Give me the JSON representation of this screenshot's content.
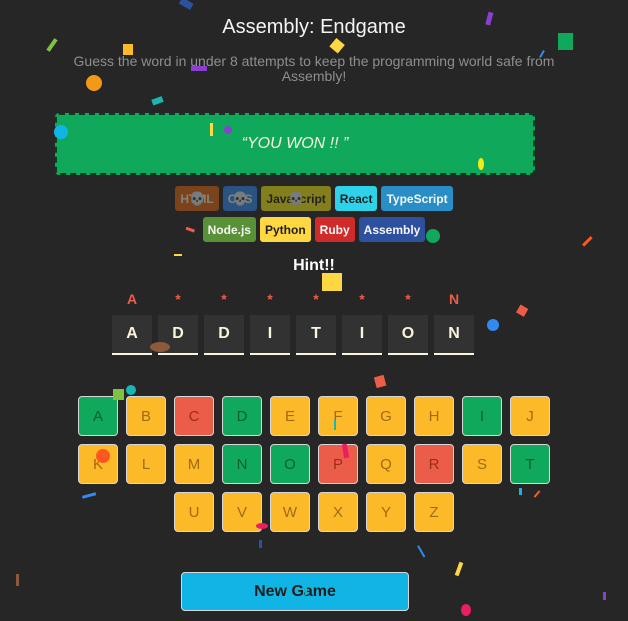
{
  "header": {
    "title": "Assembly: Endgame",
    "subtitle": "Guess the word in under 8 attempts to keep the programming world safe from Assembly!"
  },
  "status": {
    "message": "“YOU WON !! ”",
    "color": "#10a95b"
  },
  "languages": [
    {
      "name": "HTML",
      "bg": "#e2680f",
      "fg": "#f9f4da",
      "lost": true
    },
    {
      "name": "CSS",
      "bg": "#328af1",
      "fg": "#f9f4da",
      "lost": true
    },
    {
      "name": "Javascript",
      "bg": "#f4eb13",
      "fg": "#1e1e1e",
      "lost": true
    },
    {
      "name": "React",
      "bg": "#2ed3e9",
      "fg": "#1e1e1e",
      "lost": false
    },
    {
      "name": "TypeScript",
      "bg": "#298ec6",
      "fg": "#f5f5f5",
      "lost": false
    },
    {
      "name": "Node.js",
      "bg": "#599137",
      "fg": "#f5f5f5",
      "lost": false
    },
    {
      "name": "Python",
      "bg": "#ffd742",
      "fg": "#1e1e1e",
      "lost": false
    },
    {
      "name": "Ruby",
      "bg": "#d02b2b",
      "fg": "#f5f5f5",
      "lost": false
    },
    {
      "name": "Assembly",
      "bg": "#2d519f",
      "fg": "#f5f5f5",
      "lost": false
    }
  ],
  "hint": {
    "label": "Hint!!"
  },
  "hint_marks": [
    "A",
    "*",
    "*",
    "*",
    "*",
    "*",
    "*",
    "N"
  ],
  "word": [
    "A",
    "D",
    "D",
    "I",
    "T",
    "I",
    "O",
    "N"
  ],
  "keyboard": {
    "rows": [
      [
        {
          "letter": "A",
          "state": "correct"
        },
        {
          "letter": "B",
          "state": "unused"
        },
        {
          "letter": "C",
          "state": "wrong"
        },
        {
          "letter": "D",
          "state": "correct"
        },
        {
          "letter": "E",
          "state": "unused"
        },
        {
          "letter": "F",
          "state": "unused"
        },
        {
          "letter": "G",
          "state": "unused"
        },
        {
          "letter": "H",
          "state": "unused"
        },
        {
          "letter": "I",
          "state": "correct"
        },
        {
          "letter": "J",
          "state": "unused"
        }
      ],
      [
        {
          "letter": "K",
          "state": "unused"
        },
        {
          "letter": "L",
          "state": "unused"
        },
        {
          "letter": "M",
          "state": "unused"
        },
        {
          "letter": "N",
          "state": "correct"
        },
        {
          "letter": "O",
          "state": "correct"
        },
        {
          "letter": "P",
          "state": "wrong"
        },
        {
          "letter": "Q",
          "state": "unused"
        },
        {
          "letter": "R",
          "state": "wrong"
        },
        {
          "letter": "S",
          "state": "unused"
        },
        {
          "letter": "T",
          "state": "correct"
        }
      ],
      [
        {
          "letter": "U",
          "state": "unused"
        },
        {
          "letter": "V",
          "state": "unused"
        },
        {
          "letter": "W",
          "state": "unused"
        },
        {
          "letter": "X",
          "state": "unused"
        },
        {
          "letter": "Y",
          "state": "unused"
        },
        {
          "letter": "Z",
          "state": "unused"
        }
      ]
    ]
  },
  "actions": {
    "new_game": "New Game"
  },
  "icons": {
    "lost_marker": "skull-icon"
  }
}
